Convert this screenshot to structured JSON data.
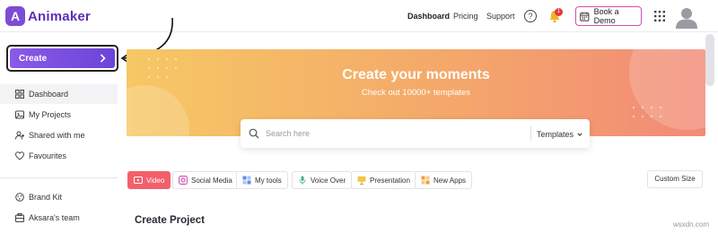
{
  "brand": {
    "logo_letter": "A",
    "name": "Animaker"
  },
  "nav": {
    "dashboard": "Dashboard",
    "pricing": "Pricing",
    "support": "Support",
    "help_icon": "?",
    "notification_count": "1",
    "book_demo": "Book a Demo"
  },
  "sidebar": {
    "create_label": "Create",
    "items": [
      {
        "label": "Dashboard",
        "icon": "grid-icon"
      },
      {
        "label": "My Projects",
        "icon": "projects-icon"
      },
      {
        "label": "Shared with me",
        "icon": "users-icon"
      },
      {
        "label": "Favourites",
        "icon": "heart-icon"
      },
      {
        "label": "Brand Kit",
        "icon": "brand-kit-icon"
      },
      {
        "label": "Aksara's team",
        "icon": "team-icon"
      }
    ]
  },
  "banner": {
    "title": "Create your moments",
    "subtitle": "Check out 10000+ templates"
  },
  "search": {
    "placeholder": "Search here",
    "filter_label": "Templates"
  },
  "tabs": [
    {
      "label": "Video",
      "active": true
    },
    {
      "label": "Social Media",
      "active": false
    },
    {
      "label": "My tools",
      "active": false
    },
    {
      "label": "Voice Over",
      "active": false
    },
    {
      "label": "Presentation",
      "active": false
    },
    {
      "label": "New Apps",
      "active": false
    }
  ],
  "custom_size": "Custom Size",
  "section_title": "Create Project",
  "watermark": "wsxdn.com",
  "colors": {
    "brand_purple": "#6b44d8",
    "active_tab": "#f2606b",
    "banner_start": "#f6c865",
    "banner_end": "#f28a78",
    "demo_border": "#d44fb8",
    "badge_red": "#e23b3b"
  }
}
